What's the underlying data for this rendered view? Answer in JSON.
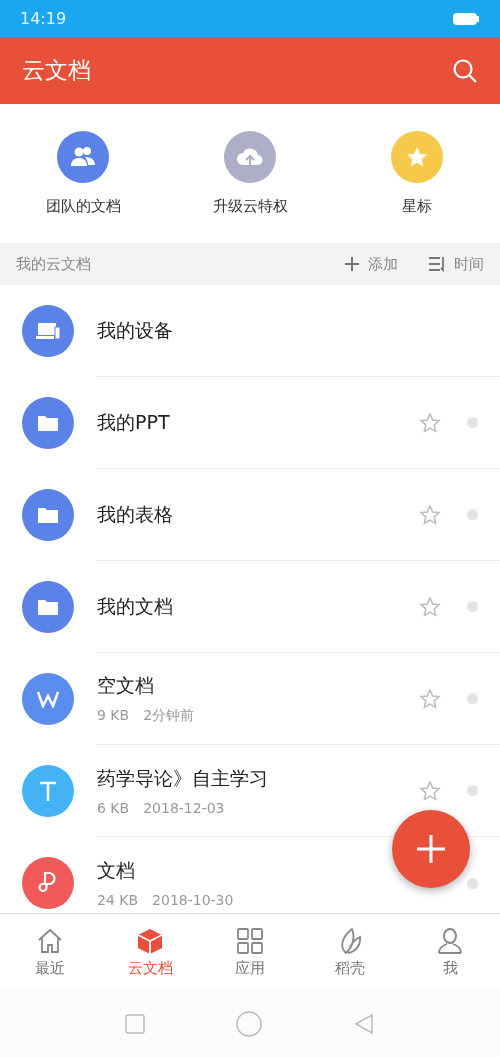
{
  "status_bar": {
    "time": "14:19"
  },
  "header": {
    "title": "云文档"
  },
  "quick_actions": [
    {
      "kind": "team",
      "label": "团队的文档"
    },
    {
      "kind": "upgrade",
      "label": "升级云特权"
    },
    {
      "kind": "star",
      "label": "星标"
    }
  ],
  "section": {
    "title": "我的云文档",
    "add": "添加",
    "sort": "时间"
  },
  "items": [
    {
      "kind": "device",
      "name": "我的设备"
    },
    {
      "kind": "folder",
      "name": "我的PPT",
      "starred": false
    },
    {
      "kind": "folder",
      "name": "我的表格",
      "starred": false
    },
    {
      "kind": "folder",
      "name": "我的文档",
      "starred": false
    },
    {
      "kind": "word",
      "name": "空文档",
      "size": "9 KB",
      "time": "2分钟前",
      "starred": false
    },
    {
      "kind": "text",
      "name": "药学导论》自主学习",
      "size": "6 KB",
      "time": "2018-12-03",
      "starred": false
    },
    {
      "kind": "pdf",
      "name": "文档",
      "size": "24 KB",
      "time": "2018-10-30"
    }
  ],
  "tabs": [
    {
      "kind": "home",
      "label": "最近",
      "selected": false
    },
    {
      "kind": "cloud",
      "label": "云文档",
      "selected": true
    },
    {
      "kind": "apps",
      "label": "应用",
      "selected": false
    },
    {
      "kind": "shell",
      "label": "稻壳",
      "selected": false
    },
    {
      "kind": "me",
      "label": "我",
      "selected": false
    }
  ]
}
